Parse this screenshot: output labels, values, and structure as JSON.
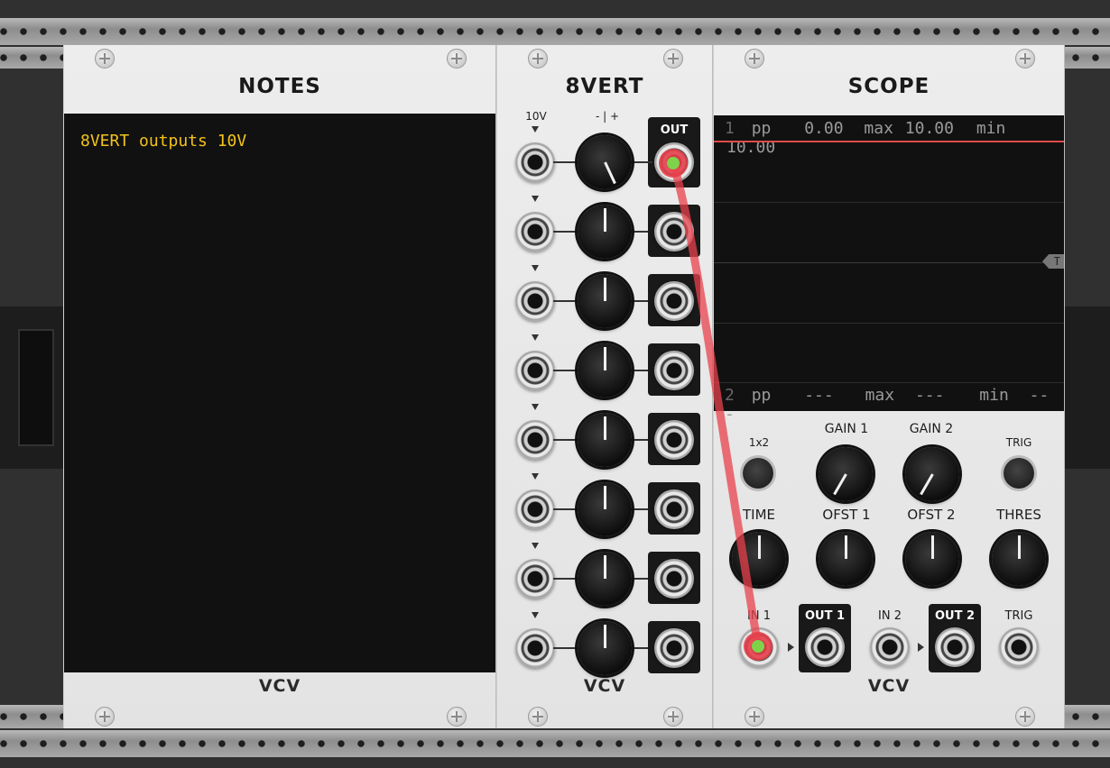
{
  "rack": {
    "notes": {
      "title": "NOTES",
      "text": "8VERT outputs 10V",
      "brand": "VCV",
      "text_color": "#f2c21b"
    },
    "eightvert": {
      "title": "8VERT",
      "label_10v": "10V",
      "label_range": "- | +",
      "label_out": "OUT",
      "brand": "VCV",
      "rows": 8
    },
    "scope": {
      "title": "SCOPE",
      "ch1": {
        "num": "1",
        "pp": "pp",
        "pp_val": "0.00",
        "max": "max",
        "max_val": "10.00",
        "min": "min",
        "min_val": "10.00"
      },
      "ch2": {
        "num": "2",
        "pp": "pp",
        "pp_val": "---",
        "max": "max",
        "max_val": "---",
        "min": "min",
        "min_val": "---"
      },
      "trigger_marker": "T",
      "labels": {
        "mode": "1x2",
        "gain1": "GAIN 1",
        "gain2": "GAIN 2",
        "trig_btn": "TRIG",
        "time": "TIME",
        "ofst1": "OFST 1",
        "ofst2": "OFST 2",
        "thres": "THRES",
        "in1": "IN 1",
        "out1": "OUT 1",
        "in2": "IN 2",
        "out2": "OUT 2",
        "trig_in": "TRIG"
      },
      "brand": "VCV",
      "trace_color": "#e04a4a"
    },
    "cable": {
      "color": "#e8414c",
      "from": "8VERT OUT 1",
      "to": "SCOPE IN 1",
      "plug_color": "#7fd34a"
    }
  }
}
